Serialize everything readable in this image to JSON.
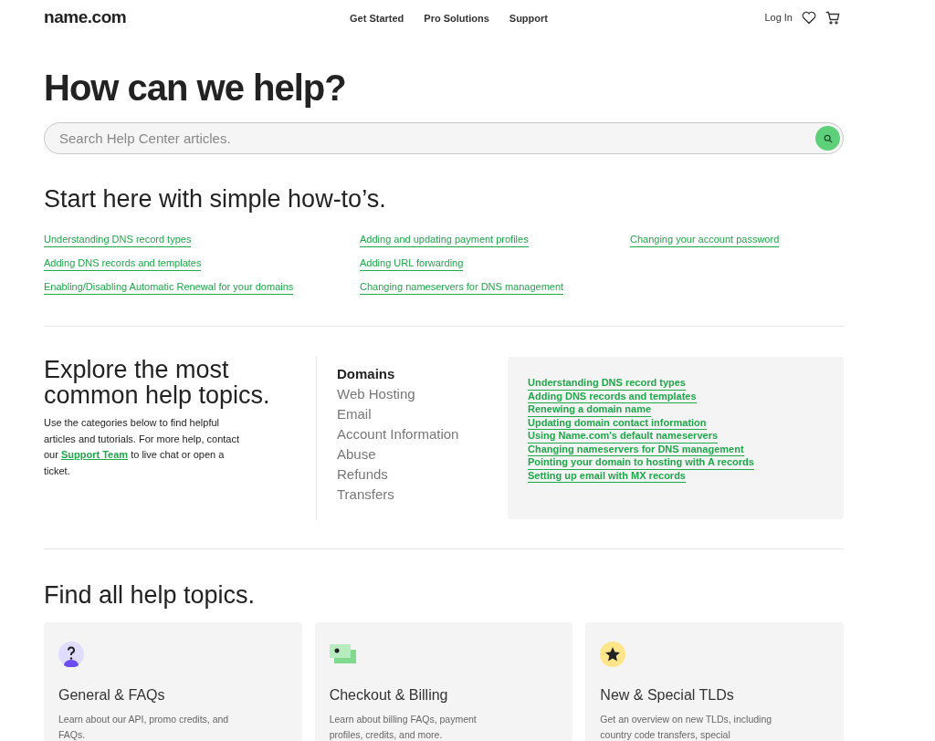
{
  "header": {
    "logo": "name.com",
    "nav": [
      "Get Started",
      "Pro Solutions",
      "Support"
    ],
    "login": "Log In"
  },
  "hero": {
    "title": "How can we help?",
    "search": {
      "placeholder": "Search Help Center articles."
    }
  },
  "howto": {
    "title": "Start here with simple how-to’s.",
    "columns": [
      [
        "Understanding DNS record types",
        "Adding DNS records and templates",
        "Enabling/Disabling Automatic Renewal for your domains"
      ],
      [
        "Adding and updating payment profiles",
        "Adding URL forwarding",
        "Changing nameservers for DNS management"
      ],
      [
        "Changing your account password"
      ]
    ]
  },
  "explore": {
    "title": "Explore the most common help topics.",
    "intro_before": "Use the categories below to find helpful articles and tutorials. For more help, contact our ",
    "intro_link": "Support Team",
    "intro_after": " to live chat or open a ticket.",
    "topics": [
      {
        "label": "Domains",
        "selected": true
      },
      {
        "label": "Web Hosting",
        "selected": false
      },
      {
        "label": "Email",
        "selected": false
      },
      {
        "label": "Account Information",
        "selected": false
      },
      {
        "label": "Abuse",
        "selected": false
      },
      {
        "label": "Refunds",
        "selected": false
      },
      {
        "label": "Transfers",
        "selected": false
      }
    ],
    "articles": [
      "Understanding DNS record types",
      "Adding DNS records and templates",
      "Renewing a domain name",
      "Updating domain contact information",
      "Using Name.com's default nameservers",
      "Changing nameservers for DNS management",
      "Pointing your domain to hosting with A records",
      "Setting up email with MX records"
    ]
  },
  "all_topics": {
    "title": "Find all help topics.",
    "cards": [
      {
        "kind": "question",
        "title": "General & FAQs",
        "description": "Learn about our API, promo credits, and FAQs."
      },
      {
        "kind": "billing",
        "title": "Checkout & Billing",
        "description": "Learn about billing FAQs, payment profiles, credits, and more."
      },
      {
        "kind": "star",
        "title": "New & Special TLDs",
        "description": "Get an overview on new TLDs, including country code transfers, special"
      }
    ]
  }
}
